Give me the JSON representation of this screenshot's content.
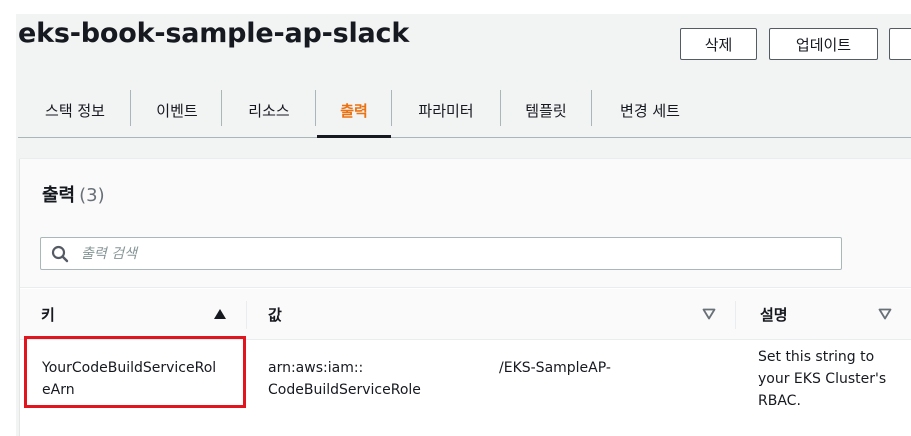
{
  "header": {
    "title": "eks-book-sample-ap-slack",
    "delete_label": "삭제",
    "update_label": "업데이트"
  },
  "tabs": [
    {
      "label": "스택 정보"
    },
    {
      "label": "이벤트"
    },
    {
      "label": "리소스"
    },
    {
      "label": "출력"
    },
    {
      "label": "파라미터"
    },
    {
      "label": "템플릿"
    },
    {
      "label": "변경 세트"
    }
  ],
  "active_tab": "출력",
  "outputs": {
    "title": "출력",
    "count": "(3)",
    "search_placeholder": "출력 검색",
    "columns": {
      "key": "키",
      "value": "값",
      "description": "설명"
    },
    "rows": [
      {
        "key_line1": "YourCodeBuildServiceRol",
        "key_line2": "eArn",
        "value_line1": "arn:aws:iam::",
        "value_line2": "CodeBuildServiceRole",
        "value_suffix": "/EKS-SampleAP-",
        "description_line1": "Set this string to",
        "description_line2": "your EKS Cluster's",
        "description_line3": "RBAC."
      }
    ]
  },
  "colors": {
    "accent_orange": "#ec7211",
    "highlight_red": "#e0151e",
    "text": "#16191f",
    "muted": "#687078"
  }
}
